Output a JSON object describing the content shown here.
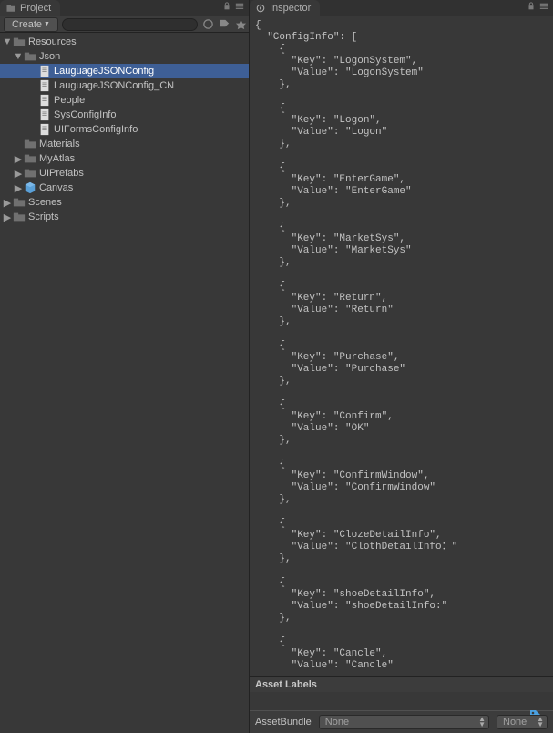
{
  "project": {
    "tab_label": "Project",
    "create_label": "Create",
    "tree": {
      "resources": "Resources",
      "json": "Json",
      "lauguage": "LauguageJSONConfig",
      "lauguage_cn": "LauguageJSONConfig_CN",
      "people": "People",
      "sysconfig": "SysConfigInfo",
      "uiforms": "UIFormsConfigInfo",
      "materials": "Materials",
      "myatlas": "MyAtlas",
      "uiprefabs": "UIPrefabs",
      "canvas": "Canvas",
      "scenes": "Scenes",
      "scripts": "Scripts"
    }
  },
  "inspector": {
    "tab_label": "Inspector",
    "json_text": "{\n  \"ConfigInfo\": [\n    {\n      \"Key\": \"LogonSystem\",\n      \"Value\": \"LogonSystem\"\n    },\n\n    {\n      \"Key\": \"Logon\",\n      \"Value\": \"Logon\"\n    },\n\n    {\n      \"Key\": \"EnterGame\",\n      \"Value\": \"EnterGame\"\n    },\n\n    {\n      \"Key\": \"MarketSys\",\n      \"Value\": \"MarketSys\"\n    },\n\n    {\n      \"Key\": \"Return\",\n      \"Value\": \"Return\"\n    },\n\n    {\n      \"Key\": \"Purchase\",\n      \"Value\": \"Purchase\"\n    },\n\n    {\n      \"Key\": \"Confirm\",\n      \"Value\": \"OK\"\n    },\n\n    {\n      \"Key\": \"ConfirmWindow\",\n      \"Value\": \"ConfirmWindow\"\n    },\n\n    {\n      \"Key\": \"ClozeDetailInfo\",\n      \"Value\": \"ClothDetailInfo：\"\n    },\n\n    {\n      \"Key\": \"shoeDetailInfo\",\n      \"Value\": \"shoeDetailInfo:\"\n    },\n\n    {\n      \"Key\": \"Cancle\",\n      \"Value\": \"Cancle\"",
    "asset_labels": "Asset Labels",
    "asset_bundle": "AssetBundle",
    "dropdown_none": "None",
    "dropdown_none2": "None"
  }
}
